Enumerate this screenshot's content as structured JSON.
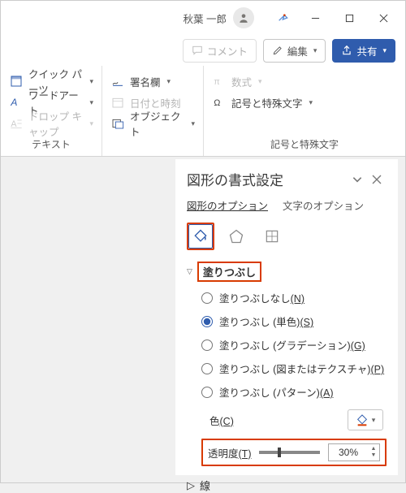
{
  "titlebar": {
    "username": "秋葉 一郎"
  },
  "quick": {
    "comment": "コメント",
    "edit": "編集",
    "share": "共有"
  },
  "ribbon": {
    "g1": {
      "quickparts": "クイック パーツ",
      "wordart": "ワードアート",
      "dropcap": "ドロップ キャップ",
      "label": "テキスト"
    },
    "g2": {
      "signature": "署名欄",
      "datetime": "日付と時刻",
      "object": "オブジェクト"
    },
    "g3": {
      "equation": "数式",
      "symbol": "記号と特殊文字",
      "label": "記号と特殊文字"
    }
  },
  "pane": {
    "title": "図形の書式設定",
    "tab_shape": "図形のオプション",
    "tab_text": "文字のオプション",
    "section_fill": "塗りつぶし",
    "radios": {
      "none": "塗りつぶしなし",
      "none_k": "(N)",
      "solid": "塗りつぶし (単色)",
      "solid_k": "(S)",
      "gradient": "塗りつぶし (グラデーション)",
      "gradient_k": "(G)",
      "picture": "塗りつぶし (図またはテクスチャ)",
      "picture_k": "(P)",
      "pattern": "塗りつぶし (パターン)",
      "pattern_k": "(A)"
    },
    "color_label": "色",
    "color_k": "(C)",
    "trans_label": "透明度",
    "trans_k": "(T)",
    "trans_value": "30%",
    "section_line": "線"
  }
}
